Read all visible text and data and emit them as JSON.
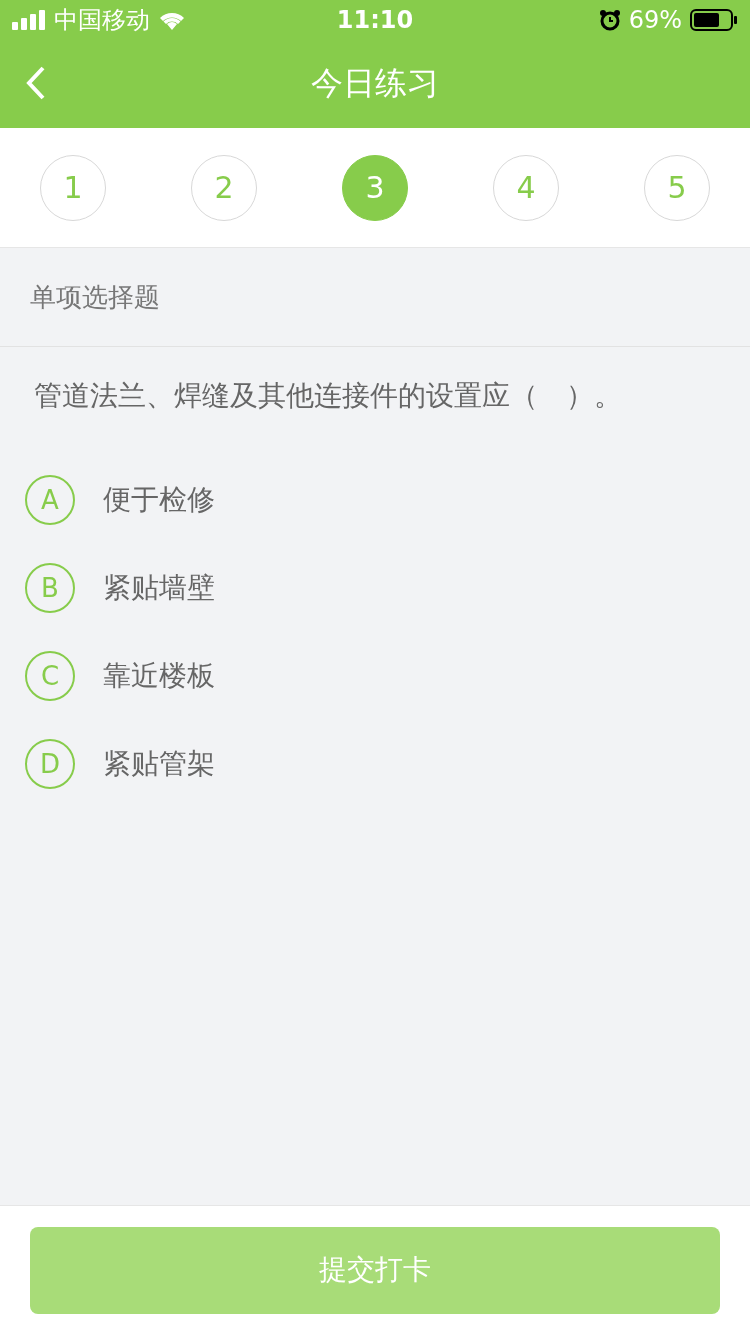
{
  "status_bar": {
    "carrier": "中国移动",
    "time": "11:10",
    "battery": "69%"
  },
  "nav": {
    "title": "今日练习"
  },
  "steps": [
    {
      "label": "1",
      "selected": false
    },
    {
      "label": "2",
      "selected": false
    },
    {
      "label": "3",
      "selected": true
    },
    {
      "label": "4",
      "selected": false
    },
    {
      "label": "5",
      "selected": false
    }
  ],
  "section": "单项选择题",
  "question": "管道法兰、焊缝及其他连接件的设置应（　）。",
  "options": [
    {
      "letter": "A",
      "text": "便于检修",
      "selected": false
    },
    {
      "letter": "B",
      "text": "紧贴墙壁",
      "selected": false
    },
    {
      "letter": "C",
      "text": "靠近楼板",
      "selected": false
    },
    {
      "letter": "D",
      "text": "紧贴管架",
      "selected": false
    }
  ],
  "submit": {
    "label": "提交打卡",
    "disabled": true
  }
}
